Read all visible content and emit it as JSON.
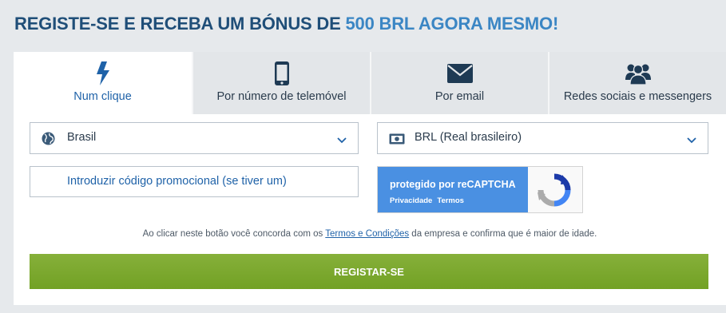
{
  "headline": {
    "text": "REGISTE-SE E RECEBA UM BÓNUS DE ",
    "highlight": "500 BRL AGORA MESMO!"
  },
  "tabs": [
    {
      "label": "Num clique",
      "icon": "lightning-icon",
      "active": true
    },
    {
      "label": "Por número de telemóvel",
      "icon": "phone-icon",
      "active": false
    },
    {
      "label": "Por email",
      "icon": "envelope-icon",
      "active": false
    },
    {
      "label": "Redes sociais e messengers",
      "icon": "users-icon",
      "active": false
    }
  ],
  "country": {
    "value": "Brasil",
    "icon": "globe-icon"
  },
  "currency": {
    "value": "BRL (Real brasileiro)",
    "icon": "banknote-icon"
  },
  "promo": {
    "placeholder": "Introduzir código promocional (se tiver um)"
  },
  "recaptcha": {
    "title": "protegido por reCAPTCHA",
    "privacy": "Privacidade",
    "terms": "Termos"
  },
  "terms_text": {
    "before": "Ao clicar neste botão você concorda com os ",
    "link": "Termos e Condições",
    "after": " da empresa e confirma que é maior de idade."
  },
  "submit_label": "REGISTAR-SE",
  "colors": {
    "heading": "#1f4e78",
    "accent": "#3b86c4",
    "link": "#1f62a8",
    "button": "#7aa82c",
    "tab_inactive": "#e3e6e9"
  }
}
